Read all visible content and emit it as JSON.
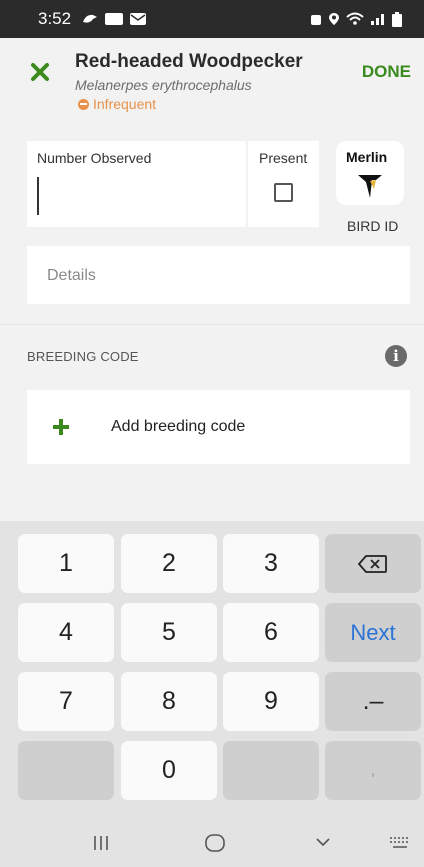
{
  "status_bar": {
    "time": "3:52"
  },
  "header": {
    "species_name": "Red-headed Woodpecker",
    "scientific_name": "Melanerpes erythrocephalus",
    "rarity": "Infrequent",
    "done_label": "DONE"
  },
  "observation": {
    "number_label": "Number Observed",
    "number_value": "",
    "present_label": "Present",
    "merlin_word": "Merlin",
    "bird_id_label": "BIRD ID",
    "details_placeholder": "Details"
  },
  "breeding": {
    "section_title": "BREEDING CODE",
    "info_glyph": "i",
    "add_label": "Add breeding code"
  },
  "keyboard": {
    "rows": [
      [
        "1",
        "2",
        "3",
        "backspace"
      ],
      [
        "4",
        "5",
        "6",
        "Next"
      ],
      [
        "7",
        "8",
        "9",
        ".–"
      ],
      [
        "",
        "0",
        "",
        ","
      ]
    ],
    "keys": {
      "k1": "1",
      "k2": "2",
      "k3": "3",
      "k4": "4",
      "k5": "5",
      "k6": "6",
      "next": "Next",
      "k7": "7",
      "k8": "8",
      "k9": "9",
      "dot_dash": ".–",
      "k0": "0",
      "comma": ","
    }
  },
  "colors": {
    "accent_green": "#3a8a1e",
    "rarity_orange": "#e8914a",
    "next_blue": "#2b73d6"
  }
}
